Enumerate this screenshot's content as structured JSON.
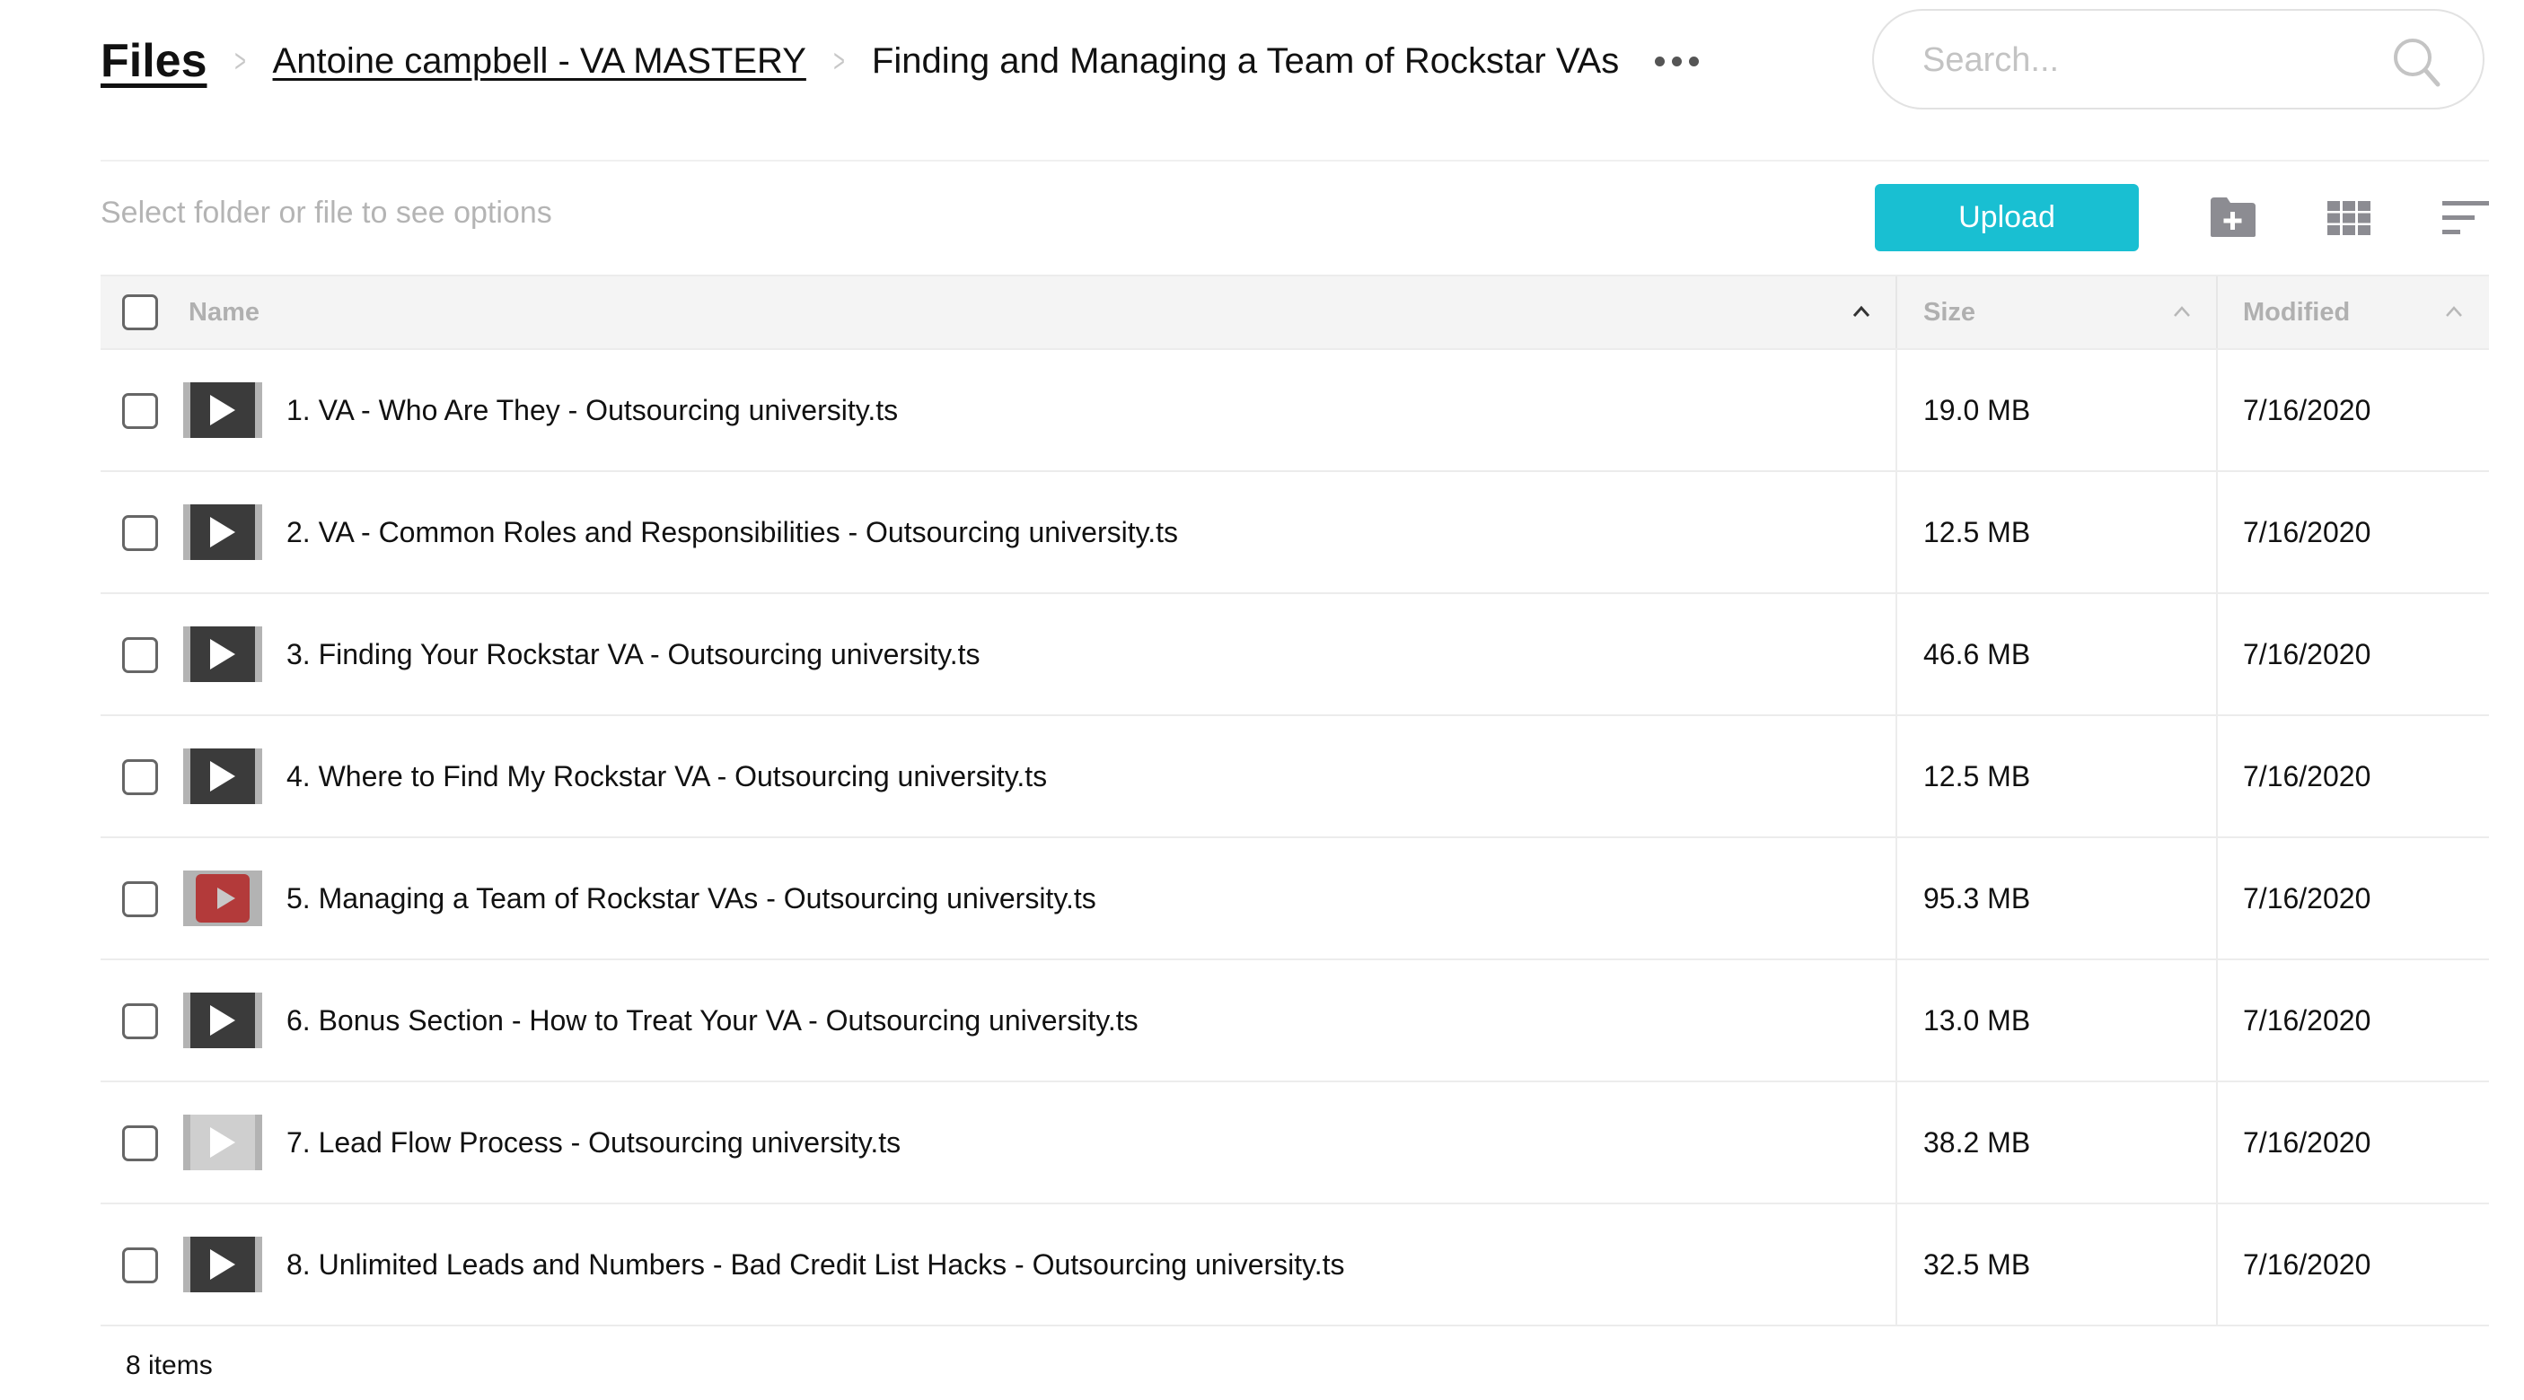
{
  "breadcrumb": {
    "root": "Files",
    "parent": "Antoine campbell - VA MASTERY",
    "current": "Finding and Managing a Team of Rockstar VAs",
    "more_icon": "more-horizontal-icon"
  },
  "search": {
    "placeholder": "Search...",
    "value": "",
    "icon": "search-icon"
  },
  "toolbar": {
    "hint": "Select folder or file to see options",
    "upload_label": "Upload",
    "upload_color": "#19bfd2",
    "icons": [
      "new-folder-icon",
      "grid-view-icon",
      "sort-icon"
    ]
  },
  "table": {
    "columns": [
      {
        "label": "Name",
        "sort": "ascending"
      },
      {
        "label": "Size",
        "sort": "ascending"
      },
      {
        "label": "Modified",
        "sort": "ascending"
      }
    ],
    "rows": [
      {
        "name": "1. VA - Who Are They - Outsourcing university.ts",
        "size": "19.0 MB",
        "modified": "7/16/2020",
        "thumb": "dark"
      },
      {
        "name": "2. VA - Common Roles and Responsibilities - Outsourcing university.ts",
        "size": "12.5 MB",
        "modified": "7/16/2020",
        "thumb": "dark"
      },
      {
        "name": "3. Finding Your Rockstar VA - Outsourcing university.ts",
        "size": "46.6 MB",
        "modified": "7/16/2020",
        "thumb": "dark"
      },
      {
        "name": "4. Where to Find My Rockstar VA - Outsourcing university.ts",
        "size": "12.5 MB",
        "modified": "7/16/2020",
        "thumb": "dark"
      },
      {
        "name": "5. Managing a Team of Rockstar VAs - Outsourcing university.ts",
        "size": "95.3 MB",
        "modified": "7/16/2020",
        "thumb": "red"
      },
      {
        "name": "6. Bonus Section - How to Treat Your VA - Outsourcing university.ts",
        "size": "13.0 MB",
        "modified": "7/16/2020",
        "thumb": "dark"
      },
      {
        "name": "7. Lead Flow Process - Outsourcing university.ts",
        "size": "38.2 MB",
        "modified": "7/16/2020",
        "thumb": "slide"
      },
      {
        "name": "8. Unlimited Leads and Numbers - Bad Credit List Hacks - Outsourcing university.ts",
        "size": "32.5 MB",
        "modified": "7/16/2020",
        "thumb": "dark"
      }
    ]
  },
  "footer": {
    "item_count": "8 items"
  }
}
